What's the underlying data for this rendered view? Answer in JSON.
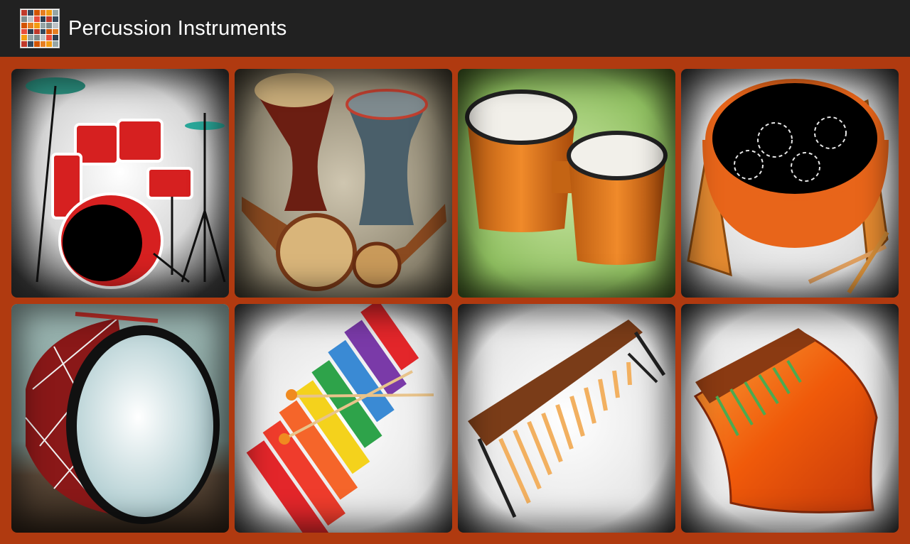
{
  "app": {
    "title": "Percussion Instruments",
    "icon": "instruments-collage-icon"
  },
  "colors": {
    "app_bar": "#212121",
    "grid_background": "#b03a10",
    "title_text": "#ffffff"
  },
  "instruments": [
    {
      "icon": "drum-kit"
    },
    {
      "icon": "darbuka-drums"
    },
    {
      "icon": "bongo-drums"
    },
    {
      "icon": "steel-pan"
    },
    {
      "icon": "bass-drum"
    },
    {
      "icon": "xylophone"
    },
    {
      "icon": "marimba"
    },
    {
      "icon": "kalimba"
    }
  ]
}
